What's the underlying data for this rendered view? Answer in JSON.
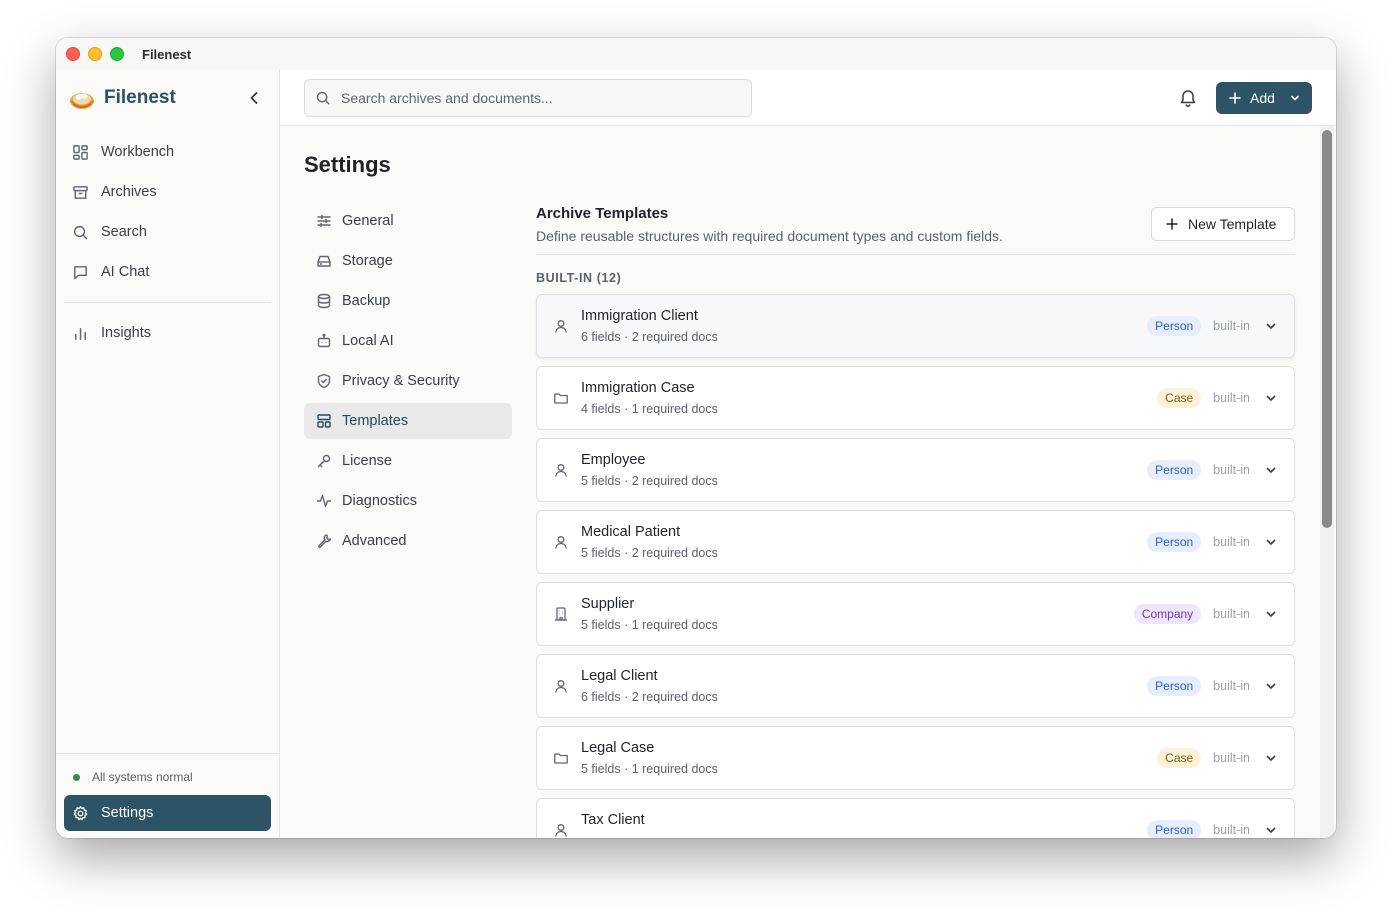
{
  "window": {
    "title": "Filenest"
  },
  "sidebar": {
    "brand": "Filenest",
    "items": [
      {
        "label": "Workbench",
        "icon": "grid-icon"
      },
      {
        "label": "Archives",
        "icon": "archive-icon"
      },
      {
        "label": "Search",
        "icon": "search-icon"
      },
      {
        "label": "AI Chat",
        "icon": "chat-icon"
      },
      {
        "label": "Insights",
        "icon": "bar-chart-icon"
      }
    ],
    "status": "All systems normal",
    "settings_label": "Settings"
  },
  "topbar": {
    "search_placeholder": "Search archives and documents...",
    "add_label": "Add"
  },
  "main": {
    "page_title": "Settings",
    "settings_nav": [
      {
        "label": "General",
        "icon": "sliders-icon"
      },
      {
        "label": "Storage",
        "icon": "drive-icon"
      },
      {
        "label": "Backup",
        "icon": "database-icon"
      },
      {
        "label": "Local AI",
        "icon": "bot-icon"
      },
      {
        "label": "Privacy & Security",
        "icon": "shield-icon"
      },
      {
        "label": "Templates",
        "icon": "layout-icon"
      },
      {
        "label": "License",
        "icon": "key-icon"
      },
      {
        "label": "Diagnostics",
        "icon": "activity-icon"
      },
      {
        "label": "Advanced",
        "icon": "wrench-icon"
      }
    ],
    "active_nav": "Templates",
    "section": {
      "title": "Archive Templates",
      "description": "Define reusable structures with required document types and custom fields.",
      "new_button": "New Template",
      "group_label": "BUILT-IN (12)"
    },
    "templates": [
      {
        "name": "Immigration Client",
        "meta": "6 fields · 2 required docs",
        "type": "Person",
        "kind": "person",
        "icon": "user-icon",
        "tag": "built-in"
      },
      {
        "name": "Immigration Case",
        "meta": "4 fields · 1 required docs",
        "type": "Case",
        "kind": "case",
        "icon": "folder-icon",
        "tag": "built-in"
      },
      {
        "name": "Employee",
        "meta": "5 fields · 2 required docs",
        "type": "Person",
        "kind": "person",
        "icon": "user-icon",
        "tag": "built-in"
      },
      {
        "name": "Medical Patient",
        "meta": "5 fields · 2 required docs",
        "type": "Person",
        "kind": "person",
        "icon": "user-icon",
        "tag": "built-in"
      },
      {
        "name": "Supplier",
        "meta": "5 fields · 1 required docs",
        "type": "Company",
        "kind": "company",
        "icon": "building-icon",
        "tag": "built-in"
      },
      {
        "name": "Legal Client",
        "meta": "6 fields · 2 required docs",
        "type": "Person",
        "kind": "person",
        "icon": "user-icon",
        "tag": "built-in"
      },
      {
        "name": "Legal Case",
        "meta": "5 fields · 1 required docs",
        "type": "Case",
        "kind": "case",
        "icon": "folder-icon",
        "tag": "built-in"
      },
      {
        "name": "Tax Client",
        "meta": "",
        "type": "Person",
        "kind": "person",
        "icon": "user-icon",
        "tag": "built-in"
      }
    ]
  },
  "colors": {
    "brand": "#2c5466",
    "person_badge": "#2f5fb8",
    "case_badge": "#8a5a10",
    "company_badge": "#6b3fb0",
    "status_ok": "#2e8b57"
  }
}
